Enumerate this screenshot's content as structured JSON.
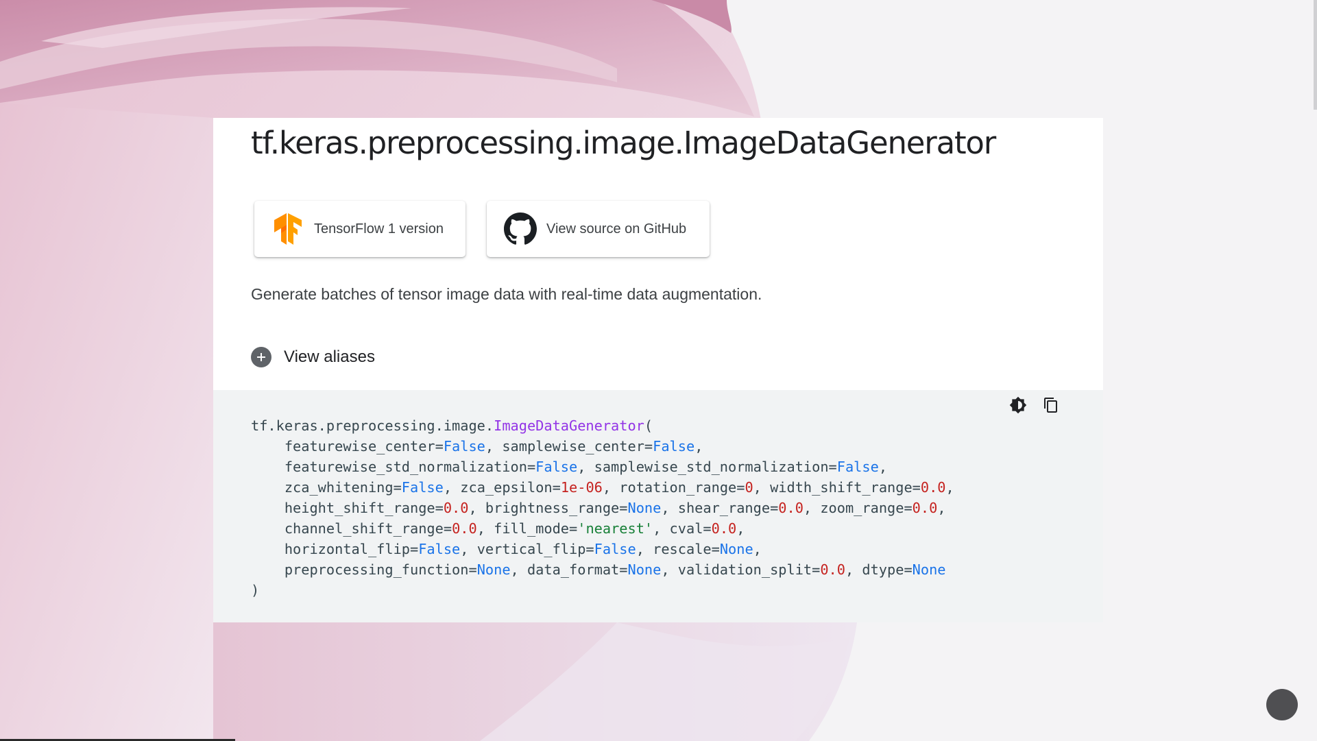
{
  "page": {
    "title": "tf.keras.preprocessing.image.ImageDataGenerator",
    "description": "Generate batches of tensor image data with real-time data augmentation."
  },
  "buttons": {
    "tf1": {
      "label": "TensorFlow 1 version",
      "icon": "tensorflow-logo-icon"
    },
    "github": {
      "label": "View source on GitHub",
      "icon": "github-icon"
    }
  },
  "aliases": {
    "label": "View aliases",
    "icon": "plus-circle-icon"
  },
  "code": {
    "tools": [
      "theme-toggle-icon",
      "copy-icon"
    ],
    "lines": [
      [
        {
          "t": "tf.keras.preprocessing.image."
        },
        {
          "t": "ImageDataGenerator",
          "c": "cls"
        },
        {
          "t": "("
        }
      ],
      [
        {
          "t": "    featurewise_center="
        },
        {
          "t": "False",
          "c": "kw"
        },
        {
          "t": ", samplewise_center="
        },
        {
          "t": "False",
          "c": "kw"
        },
        {
          "t": ","
        }
      ],
      [
        {
          "t": "    featurewise_std_normalization="
        },
        {
          "t": "False",
          "c": "kw"
        },
        {
          "t": ", samplewise_std_normalization="
        },
        {
          "t": "False",
          "c": "kw"
        },
        {
          "t": ","
        }
      ],
      [
        {
          "t": "    zca_whitening="
        },
        {
          "t": "False",
          "c": "kw"
        },
        {
          "t": ", zca_epsilon="
        },
        {
          "t": "1e-06",
          "c": "num"
        },
        {
          "t": ", rotation_range="
        },
        {
          "t": "0",
          "c": "num"
        },
        {
          "t": ", width_shift_range="
        },
        {
          "t": "0.0",
          "c": "num"
        },
        {
          "t": ","
        }
      ],
      [
        {
          "t": "    height_shift_range="
        },
        {
          "t": "0.0",
          "c": "num"
        },
        {
          "t": ", brightness_range="
        },
        {
          "t": "None",
          "c": "kw"
        },
        {
          "t": ", shear_range="
        },
        {
          "t": "0.0",
          "c": "num"
        },
        {
          "t": ", zoom_range="
        },
        {
          "t": "0.0",
          "c": "num"
        },
        {
          "t": ","
        }
      ],
      [
        {
          "t": "    channel_shift_range="
        },
        {
          "t": "0.0",
          "c": "num"
        },
        {
          "t": ", fill_mode="
        },
        {
          "t": "'nearest'",
          "c": "str"
        },
        {
          "t": ", cval="
        },
        {
          "t": "0.0",
          "c": "num"
        },
        {
          "t": ","
        }
      ],
      [
        {
          "t": "    horizontal_flip="
        },
        {
          "t": "False",
          "c": "kw"
        },
        {
          "t": ", vertical_flip="
        },
        {
          "t": "False",
          "c": "kw"
        },
        {
          "t": ", rescale="
        },
        {
          "t": "None",
          "c": "kw"
        },
        {
          "t": ","
        }
      ],
      [
        {
          "t": "    preprocessing_function="
        },
        {
          "t": "None",
          "c": "kw"
        },
        {
          "t": ", data_format="
        },
        {
          "t": "None",
          "c": "kw"
        },
        {
          "t": ", validation_split="
        },
        {
          "t": "0.0",
          "c": "num"
        },
        {
          "t": ", dtype="
        },
        {
          "t": "None",
          "c": "kw"
        }
      ],
      [
        {
          "t": ")"
        }
      ]
    ]
  },
  "colors": {
    "keyword": "#1a73e8",
    "number": "#c5221f",
    "string": "#188038",
    "class": "#9334e6",
    "background_accent": "#d9a6c0"
  }
}
